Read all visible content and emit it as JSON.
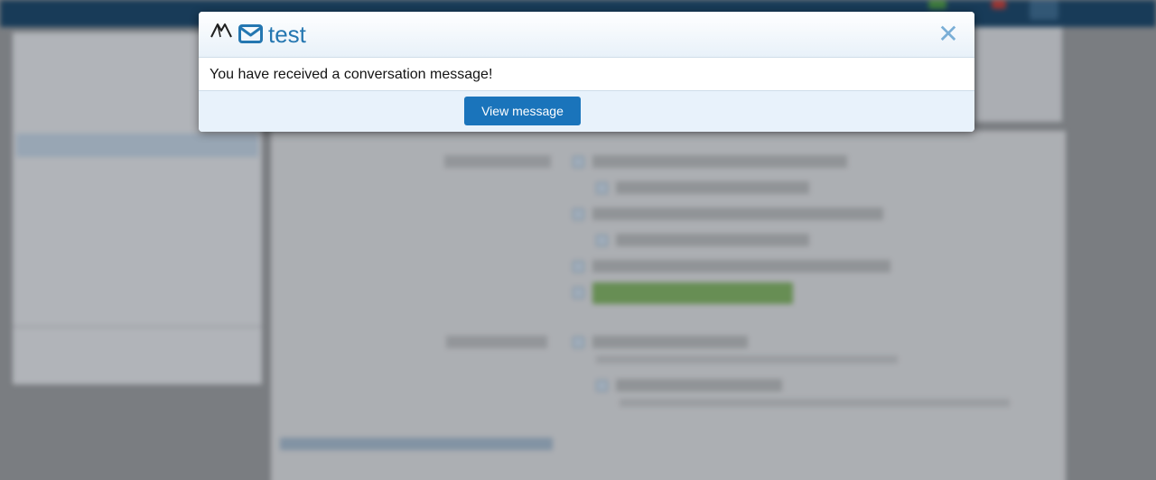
{
  "modal": {
    "title": "test",
    "message": "You have received a conversation message!",
    "button_label": "View message",
    "close_symbol": "✕",
    "accent_color": "#2577b1",
    "button_color": "#1a74bb"
  },
  "icons": {
    "logo": "site-logo-icon",
    "envelope": "envelope-icon",
    "close": "close-icon"
  }
}
